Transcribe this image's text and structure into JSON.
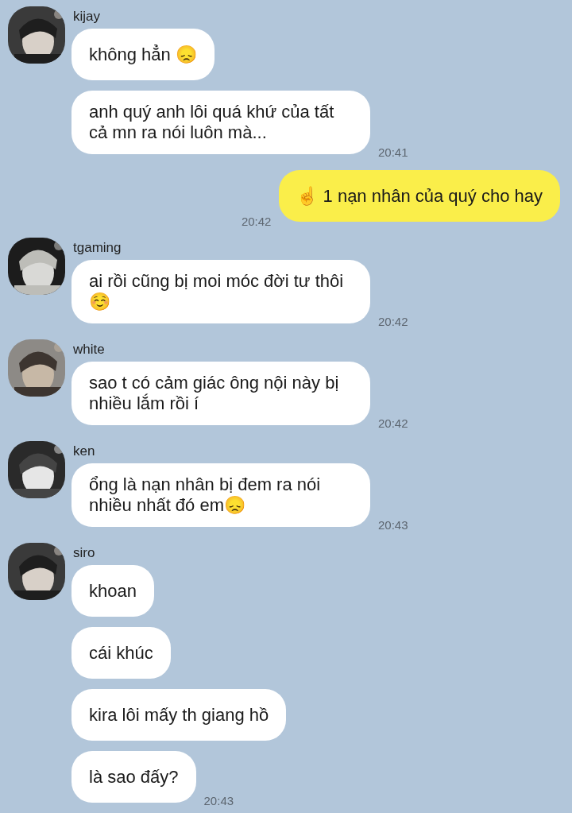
{
  "messages": [
    {
      "kind": "incoming",
      "sender": "kijay",
      "bubbles": [
        {
          "text": "không hẳn 😞"
        },
        {
          "text": "anh quý anh lôi quá khứ của tất cả mn ra nói luôn mà...",
          "time": "20:41"
        }
      ]
    },
    {
      "kind": "outgoing",
      "bubbles": [
        {
          "text": "☝️ 1 nạn nhân của quý cho hay",
          "time": "20:42"
        }
      ]
    },
    {
      "kind": "incoming",
      "sender": "tgaming",
      "bubbles": [
        {
          "text": "ai rồi cũng bị moi móc đời tư thôi☺️",
          "time": "20:42"
        }
      ]
    },
    {
      "kind": "incoming",
      "sender": "white",
      "bubbles": [
        {
          "text": "sao t có cảm giác ông nội này bị nhiều lắm rồi í",
          "time": "20:42"
        }
      ]
    },
    {
      "kind": "incoming",
      "sender": "ken",
      "bubbles": [
        {
          "text": "ổng là nạn nhân bị đem ra nói nhiều nhất đó em😞",
          "time": "20:43"
        }
      ]
    },
    {
      "kind": "incoming",
      "sender": "siro",
      "bubbles": [
        {
          "text": "khoan"
        },
        {
          "text": "cái khúc"
        },
        {
          "text": "kira lôi mấy th giang hồ"
        },
        {
          "text": "là sao đấy?",
          "time": "20:43"
        }
      ]
    }
  ]
}
